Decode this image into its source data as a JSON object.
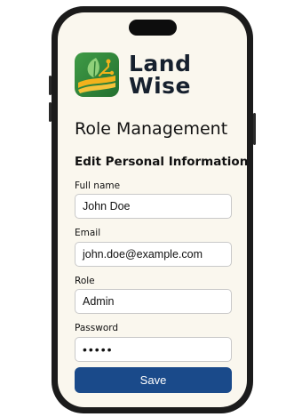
{
  "app": {
    "logo_line1": "Land",
    "logo_line2": "Wise"
  },
  "page": {
    "title": "Role Management",
    "section_title": "Edit Personal Information"
  },
  "form": {
    "full_name_label": "Full name",
    "full_name_value": "John Doe",
    "email_label": "Email",
    "email_value": "john.doe@example.com",
    "role_label": "Role",
    "role_value": "Admin",
    "password_label": "Password",
    "password_value": "•••••",
    "save_label": "Save"
  },
  "colors": {
    "primary": "#1a4a8a",
    "logo_green": "#2e8b3e",
    "logo_yellow": "#f2b21c",
    "screen_bg": "#faf7ee"
  },
  "icons": {
    "logo": "leaf-field-logo-icon"
  }
}
